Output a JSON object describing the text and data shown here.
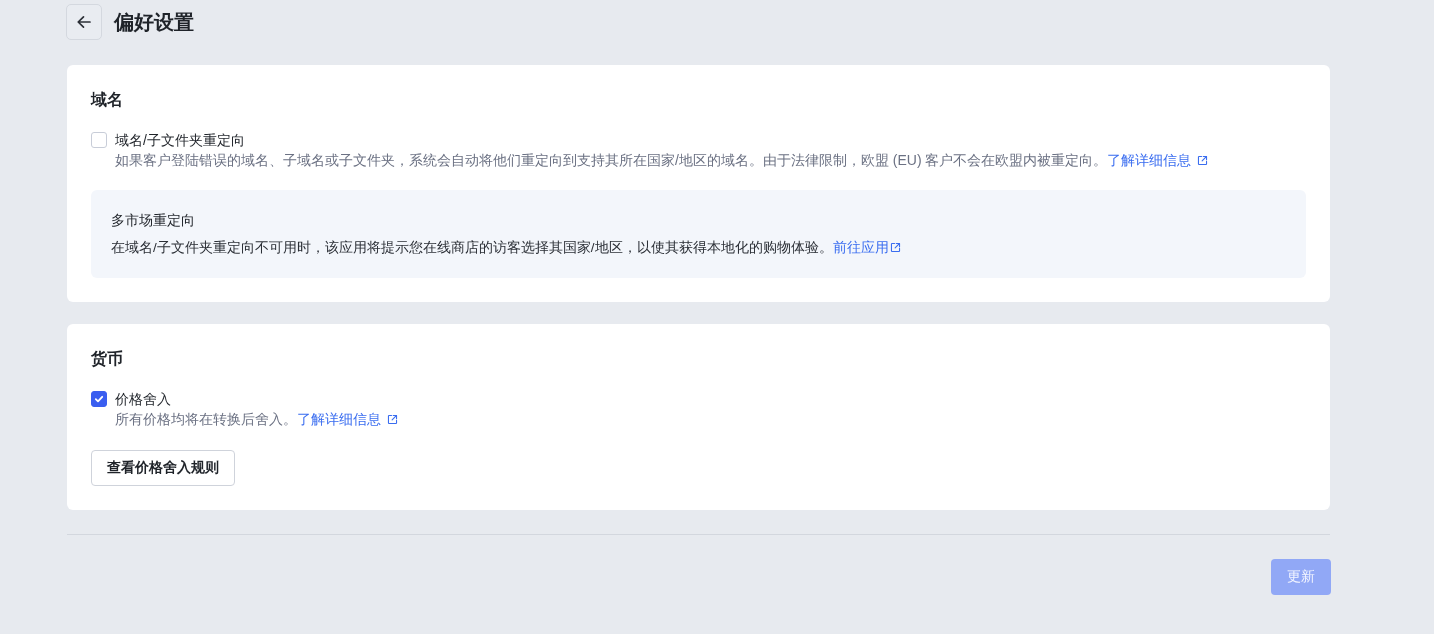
{
  "header": {
    "title": "偏好设置"
  },
  "sections": [
    {
      "title": "域名",
      "options": [
        {
          "label": "域名/子文件夹重定向",
          "checked": false,
          "description": "如果客户登陆错误的域名、子域名或子文件夹，系统会自动将他们重定向到支持其所在国家/地区的域名。由于法律限制，欧盟 (EU) 客户不会在欧盟内被重定向。",
          "link": "了解详细信息"
        }
      ],
      "notice": {
        "title": "多市场重定向",
        "text": "在域名/子文件夹重定向不可用时，该应用将提示您在线商店的访客选择其国家/地区，以使其获得本地化的购物体验。",
        "link": "前往应用"
      }
    },
    {
      "title": "货币",
      "options": [
        {
          "label": "价格舍入",
          "checked": true,
          "description": "所有价格均将在转换后舍入。",
          "link": "了解详细信息"
        }
      ],
      "button": "查看价格舍入规则"
    }
  ],
  "footer": {
    "update_button": {
      "label": "更新",
      "disabled": true
    }
  }
}
